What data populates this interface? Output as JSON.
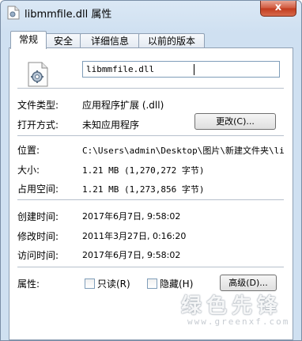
{
  "window": {
    "title": "libmmfile.dll 属性",
    "close_glyph": "x"
  },
  "tabs": [
    {
      "label": "常规",
      "active": true
    },
    {
      "label": "安全",
      "active": false
    },
    {
      "label": "详细信息",
      "active": false
    },
    {
      "label": "以前的版本",
      "active": false
    }
  ],
  "general": {
    "file_name": "libmmfile.dll",
    "file_type_label": "文件类型:",
    "file_type_value": "应用程序扩展 (.dll)",
    "open_with_label": "打开方式:",
    "open_with_value": "未知应用程序",
    "change_button": "更改(C)...",
    "location_label": "位置:",
    "location_value": "C:\\Users\\admin\\Desktop\\图片\\新建文件夹\\li",
    "size_label": "大小:",
    "size_value": "1.21 MB (1,270,272 字节)",
    "size_on_disk_label": "占用空间:",
    "size_on_disk_value": "1.21 MB (1,273,856 字节)",
    "created_label": "创建时间:",
    "created_value": "2017年6月7日, 9:58:02",
    "modified_label": "修改时间:",
    "modified_value": "2011年3月27日, 0:16:20",
    "accessed_label": "访问时间:",
    "accessed_value": "2017年6月7日, 9:58:02",
    "attributes_label": "属性:",
    "readonly_label": "只读(R)",
    "readonly_checked": false,
    "hidden_label": "隐藏(H)",
    "hidden_checked": false,
    "advanced_button": "高级(D)..."
  },
  "watermark": {
    "text": "绿色先锋",
    "url": "www.greenxf.com"
  },
  "colors": {
    "titlebar": "#dbe8f5",
    "close_button": "#c13a1d",
    "panel_border": "#8fa0b4"
  }
}
